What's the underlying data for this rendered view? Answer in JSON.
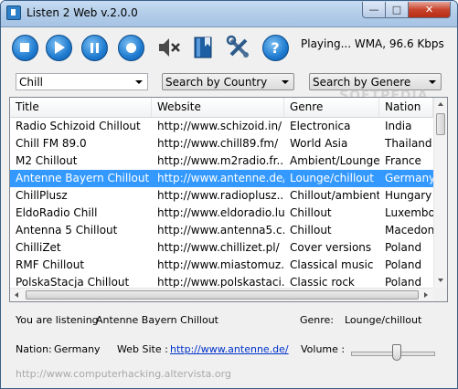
{
  "window": {
    "title": "Listen 2 Web v.2.0.0"
  },
  "toolbar": {
    "buttons": [
      {
        "name": "stop-button",
        "icon": "stop-icon"
      },
      {
        "name": "play-button",
        "icon": "play-icon"
      },
      {
        "name": "pause-button",
        "icon": "pause-icon"
      },
      {
        "name": "record-button",
        "icon": "record-icon"
      },
      {
        "name": "mute-button",
        "icon": "mute-icon"
      },
      {
        "name": "bookmark-button",
        "icon": "bookmark-icon"
      },
      {
        "name": "settings-button",
        "icon": "tools-icon"
      },
      {
        "name": "help-button",
        "icon": "help-icon"
      }
    ],
    "status": "Playing... WMA, 96.6 Kbps"
  },
  "filters": {
    "genre_filter": "Chill",
    "search_country": "Search by Country",
    "search_genre": "Search by Genere"
  },
  "table": {
    "columns": [
      "Title",
      "Website",
      "Genre",
      "Nation"
    ],
    "rows": [
      [
        "Radio Schizoid Chillout",
        "http://www.schizoid.in/",
        "Electronica",
        "India"
      ],
      [
        "Chill FM 89.0",
        "http://www.chill89.fm/",
        "World Asia",
        "Thailand"
      ],
      [
        "M2 Chillout",
        "http://www.m2radio.fr...",
        "Ambient/Lounge",
        "France"
      ],
      [
        "Antenne Bayern Chillout",
        "http://www.antenne.de/",
        "Lounge/chillout",
        "Germany"
      ],
      [
        "ChillPlusz",
        "http://www.radioplusz....",
        "Chillout/ambient",
        "Hungary"
      ],
      [
        "EldoRadio Chill",
        "http://www.eldoradio.lu/",
        "Chillout",
        "Luxembo..."
      ],
      [
        "Antenna 5 Chillout",
        "http://www.antenna5.c...",
        "Chillout",
        "Macedonia"
      ],
      [
        "ChilliZet",
        "http://www.chillizet.pl/",
        "Cover versions",
        "Poland"
      ],
      [
        "RMF Chillout",
        "http://www.miastomuz...",
        "Classical music",
        "Poland"
      ],
      [
        "PolskaStacja Chillout",
        "http://www.polskastaci...",
        "Classic rock",
        "Poland"
      ]
    ],
    "selected_index": 3
  },
  "info": {
    "listening_label": "You are listening",
    "listening_value": "Antenne Bayern Chillout",
    "genre_label": "Genre:",
    "genre_value": "Lounge/chillout",
    "nation_label": "Nation:",
    "nation_value": "Germany",
    "website_label": "Web Site :",
    "website_value": "http://www.antenne.de/",
    "volume_label": "Volume :",
    "volume_level": 0.55
  },
  "footer": "http://www.computerhacking.altervista.org",
  "watermark": "SOFTPEDIA",
  "colors": {
    "selection": "#3399ff",
    "accent": "#1e7bd0",
    "link": "#0033cc"
  }
}
